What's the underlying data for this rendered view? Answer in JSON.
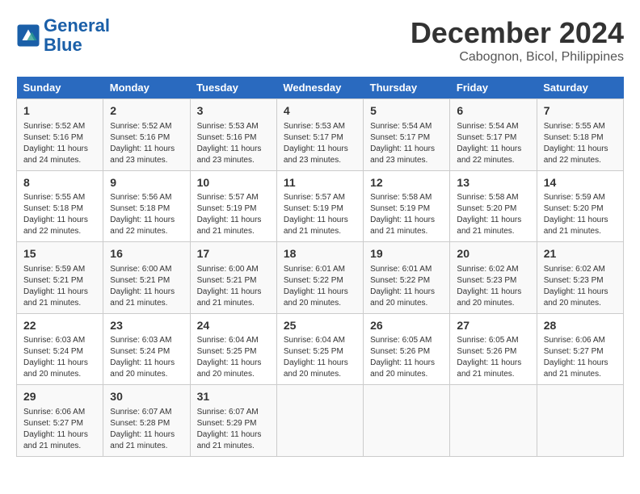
{
  "header": {
    "logo_line1": "General",
    "logo_line2": "Blue",
    "month": "December 2024",
    "location": "Cabognon, Bicol, Philippines"
  },
  "days_of_week": [
    "Sunday",
    "Monday",
    "Tuesday",
    "Wednesday",
    "Thursday",
    "Friday",
    "Saturday"
  ],
  "weeks": [
    [
      {
        "day": "1",
        "info": "Sunrise: 5:52 AM\nSunset: 5:16 PM\nDaylight: 11 hours\nand 24 minutes."
      },
      {
        "day": "2",
        "info": "Sunrise: 5:52 AM\nSunset: 5:16 PM\nDaylight: 11 hours\nand 23 minutes."
      },
      {
        "day": "3",
        "info": "Sunrise: 5:53 AM\nSunset: 5:16 PM\nDaylight: 11 hours\nand 23 minutes."
      },
      {
        "day": "4",
        "info": "Sunrise: 5:53 AM\nSunset: 5:17 PM\nDaylight: 11 hours\nand 23 minutes."
      },
      {
        "day": "5",
        "info": "Sunrise: 5:54 AM\nSunset: 5:17 PM\nDaylight: 11 hours\nand 23 minutes."
      },
      {
        "day": "6",
        "info": "Sunrise: 5:54 AM\nSunset: 5:17 PM\nDaylight: 11 hours\nand 22 minutes."
      },
      {
        "day": "7",
        "info": "Sunrise: 5:55 AM\nSunset: 5:18 PM\nDaylight: 11 hours\nand 22 minutes."
      }
    ],
    [
      {
        "day": "8",
        "info": "Sunrise: 5:55 AM\nSunset: 5:18 PM\nDaylight: 11 hours\nand 22 minutes."
      },
      {
        "day": "9",
        "info": "Sunrise: 5:56 AM\nSunset: 5:18 PM\nDaylight: 11 hours\nand 22 minutes."
      },
      {
        "day": "10",
        "info": "Sunrise: 5:57 AM\nSunset: 5:19 PM\nDaylight: 11 hours\nand 21 minutes."
      },
      {
        "day": "11",
        "info": "Sunrise: 5:57 AM\nSunset: 5:19 PM\nDaylight: 11 hours\nand 21 minutes."
      },
      {
        "day": "12",
        "info": "Sunrise: 5:58 AM\nSunset: 5:19 PM\nDaylight: 11 hours\nand 21 minutes."
      },
      {
        "day": "13",
        "info": "Sunrise: 5:58 AM\nSunset: 5:20 PM\nDaylight: 11 hours\nand 21 minutes."
      },
      {
        "day": "14",
        "info": "Sunrise: 5:59 AM\nSunset: 5:20 PM\nDaylight: 11 hours\nand 21 minutes."
      }
    ],
    [
      {
        "day": "15",
        "info": "Sunrise: 5:59 AM\nSunset: 5:21 PM\nDaylight: 11 hours\nand 21 minutes."
      },
      {
        "day": "16",
        "info": "Sunrise: 6:00 AM\nSunset: 5:21 PM\nDaylight: 11 hours\nand 21 minutes."
      },
      {
        "day": "17",
        "info": "Sunrise: 6:00 AM\nSunset: 5:21 PM\nDaylight: 11 hours\nand 21 minutes."
      },
      {
        "day": "18",
        "info": "Sunrise: 6:01 AM\nSunset: 5:22 PM\nDaylight: 11 hours\nand 20 minutes."
      },
      {
        "day": "19",
        "info": "Sunrise: 6:01 AM\nSunset: 5:22 PM\nDaylight: 11 hours\nand 20 minutes."
      },
      {
        "day": "20",
        "info": "Sunrise: 6:02 AM\nSunset: 5:23 PM\nDaylight: 11 hours\nand 20 minutes."
      },
      {
        "day": "21",
        "info": "Sunrise: 6:02 AM\nSunset: 5:23 PM\nDaylight: 11 hours\nand 20 minutes."
      }
    ],
    [
      {
        "day": "22",
        "info": "Sunrise: 6:03 AM\nSunset: 5:24 PM\nDaylight: 11 hours\nand 20 minutes."
      },
      {
        "day": "23",
        "info": "Sunrise: 6:03 AM\nSunset: 5:24 PM\nDaylight: 11 hours\nand 20 minutes."
      },
      {
        "day": "24",
        "info": "Sunrise: 6:04 AM\nSunset: 5:25 PM\nDaylight: 11 hours\nand 20 minutes."
      },
      {
        "day": "25",
        "info": "Sunrise: 6:04 AM\nSunset: 5:25 PM\nDaylight: 11 hours\nand 20 minutes."
      },
      {
        "day": "26",
        "info": "Sunrise: 6:05 AM\nSunset: 5:26 PM\nDaylight: 11 hours\nand 20 minutes."
      },
      {
        "day": "27",
        "info": "Sunrise: 6:05 AM\nSunset: 5:26 PM\nDaylight: 11 hours\nand 21 minutes."
      },
      {
        "day": "28",
        "info": "Sunrise: 6:06 AM\nSunset: 5:27 PM\nDaylight: 11 hours\nand 21 minutes."
      }
    ],
    [
      {
        "day": "29",
        "info": "Sunrise: 6:06 AM\nSunset: 5:27 PM\nDaylight: 11 hours\nand 21 minutes."
      },
      {
        "day": "30",
        "info": "Sunrise: 6:07 AM\nSunset: 5:28 PM\nDaylight: 11 hours\nand 21 minutes."
      },
      {
        "day": "31",
        "info": "Sunrise: 6:07 AM\nSunset: 5:29 PM\nDaylight: 11 hours\nand 21 minutes."
      },
      {
        "day": "",
        "info": ""
      },
      {
        "day": "",
        "info": ""
      },
      {
        "day": "",
        "info": ""
      },
      {
        "day": "",
        "info": ""
      }
    ]
  ]
}
